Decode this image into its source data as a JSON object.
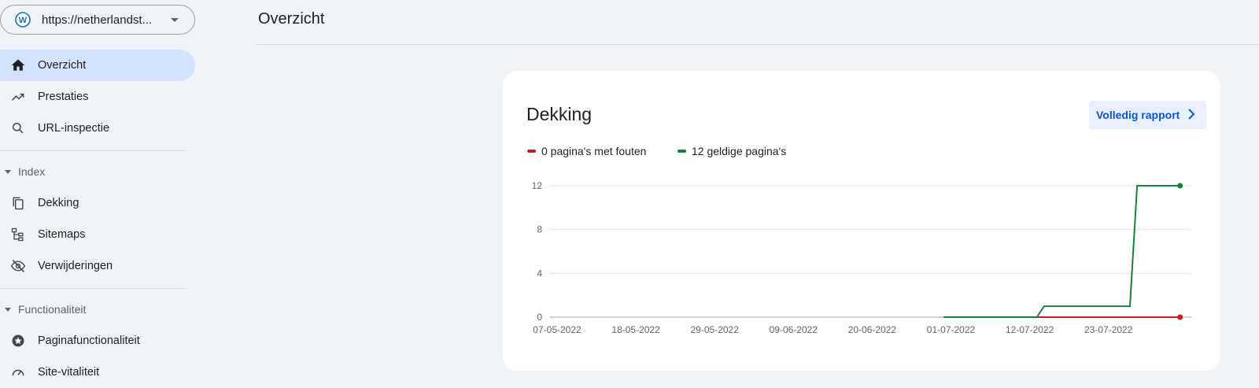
{
  "property": {
    "url": "https://netherlandst..."
  },
  "nav": {
    "overview": "Overzicht",
    "performance": "Prestaties",
    "url_inspection": "URL-inspectie",
    "index_section": "Index",
    "coverage": "Dekking",
    "sitemaps": "Sitemaps",
    "removals": "Verwijderingen",
    "functionality_section": "Functionaliteit",
    "page_experience": "Paginafunctionaliteit",
    "core_web_vitals": "Site-vitaliteit"
  },
  "header": {
    "title": "Overzicht"
  },
  "card": {
    "title": "Dekking",
    "full_report_label": "Volledig rapport",
    "legend_errors": "0 pagina's met fouten",
    "legend_valid": "12 geldige pagina's"
  },
  "colors": {
    "errors": "#c5221f",
    "valid": "#188038",
    "accent": "#0b57d0",
    "active_nav": "#d3e3fd"
  },
  "chart_data": {
    "type": "line",
    "ylim": [
      0,
      12
    ],
    "yticks": [
      "0",
      "4",
      "8",
      "12"
    ],
    "xticks": [
      "07-05-2022",
      "18-05-2022",
      "29-05-2022",
      "09-06-2022",
      "20-06-2022",
      "01-07-2022",
      "12-07-2022",
      "23-07-2022"
    ],
    "series": [
      {
        "name": "0 pagina's met fouten",
        "color": "#c5221f",
        "points": [
          [
            "2022-06-30",
            0
          ],
          [
            "2022-08-02",
            0
          ]
        ]
      },
      {
        "name": "12 geldige pagina's",
        "color": "#188038",
        "points": [
          [
            "2022-06-30",
            0
          ],
          [
            "2022-07-13",
            0
          ],
          [
            "2022-07-14",
            1
          ],
          [
            "2022-07-26",
            1
          ],
          [
            "2022-07-27",
            12
          ],
          [
            "2022-08-02",
            12
          ]
        ]
      }
    ]
  }
}
